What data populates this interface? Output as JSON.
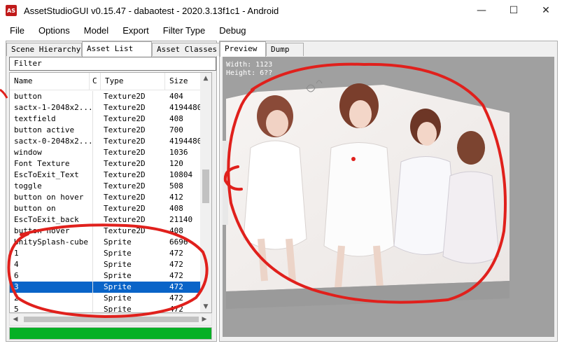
{
  "window": {
    "title": "AssetStudioGUI v0.15.47 - dabaotest - 2020.3.13f1c1 - Android",
    "icon": "AS",
    "controls": {
      "minimize": "—",
      "maximize": "☐",
      "close": "✕"
    }
  },
  "menu": [
    "File",
    "Options",
    "Model",
    "Export",
    "Filter Type",
    "Debug"
  ],
  "left_tabs": [
    "Scene Hierarchy",
    "Asset List",
    "Asset Classes"
  ],
  "filter_label": "Filter",
  "columns": {
    "name": "Name",
    "container": "C",
    "type": "Type",
    "size": "Size"
  },
  "rows": [
    {
      "name": "button",
      "type": "Texture2D",
      "size": "404"
    },
    {
      "name": "sactx-1-2048x2...",
      "type": "Texture2D",
      "size": "4194480"
    },
    {
      "name": "textfield",
      "type": "Texture2D",
      "size": "408"
    },
    {
      "name": "button active",
      "type": "Texture2D",
      "size": "700"
    },
    {
      "name": "sactx-0-2048x2...",
      "type": "Texture2D",
      "size": "4194480"
    },
    {
      "name": "window",
      "type": "Texture2D",
      "size": "1036"
    },
    {
      "name": "Font Texture",
      "type": "Texture2D",
      "size": "120"
    },
    {
      "name": "EscToExit_Text",
      "type": "Texture2D",
      "size": "10804"
    },
    {
      "name": "toggle",
      "type": "Texture2D",
      "size": "508"
    },
    {
      "name": "button on hover",
      "type": "Texture2D",
      "size": "412"
    },
    {
      "name": "button on",
      "type": "Texture2D",
      "size": "408"
    },
    {
      "name": "EscToExit_back",
      "type": "Texture2D",
      "size": "21140"
    },
    {
      "name": "button hover",
      "type": "Texture2D",
      "size": "408"
    },
    {
      "name": "UnitySplash-cube",
      "type": "Sprite",
      "size": "6696"
    },
    {
      "name": "1",
      "type": "Sprite",
      "size": "472"
    },
    {
      "name": "4",
      "type": "Sprite",
      "size": "472"
    },
    {
      "name": "6",
      "type": "Sprite",
      "size": "472"
    },
    {
      "name": "3",
      "type": "Sprite",
      "size": "472",
      "selected": true
    },
    {
      "name": "2",
      "type": "Sprite",
      "size": "472"
    },
    {
      "name": "5",
      "type": "Sprite",
      "size": "472"
    }
  ],
  "progress": {
    "fraction": 1.0,
    "color": "#06b025"
  },
  "right_tabs": [
    "Preview",
    "Dump"
  ],
  "preview_info": {
    "width_line": "Width: 1123",
    "height_line": "Height: 6??"
  },
  "colors": {
    "selection": "#0a64c8",
    "annotation": "#e0201c",
    "preview_bg": "#a0a0a0"
  }
}
